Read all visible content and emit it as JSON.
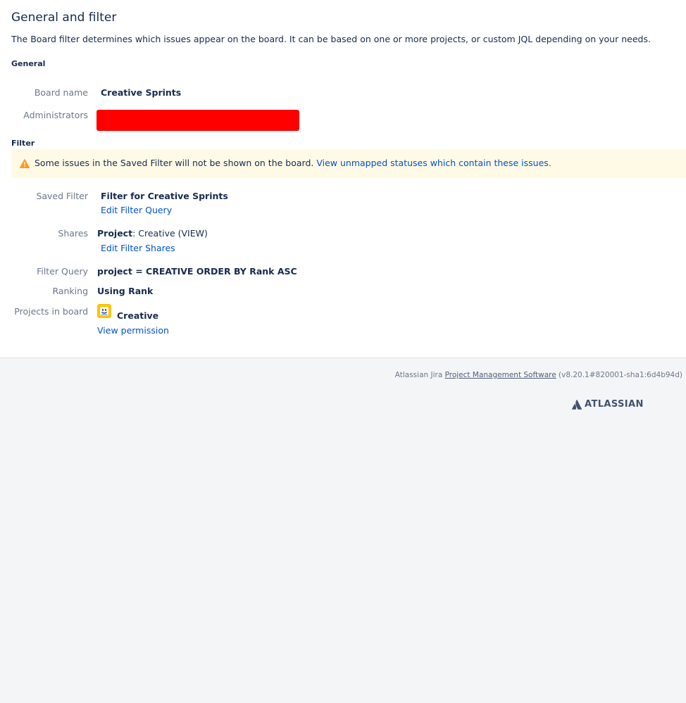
{
  "page": {
    "title": "General and filter",
    "description": "The Board filter determines which issues appear on the board. It can be based on one or more projects, or custom JQL depending on your needs."
  },
  "general": {
    "heading": "General",
    "board_name_label": "Board name",
    "board_name_value": "Creative Sprints",
    "administrators_label": "Administrators"
  },
  "filter": {
    "heading": "Filter",
    "warning_text": "Some issues in the Saved Filter will not be shown on the board.",
    "warning_link": "View unmapped statuses which contain these issues.",
    "saved_filter_label": "Saved Filter",
    "saved_filter_value": "Filter for Creative Sprints",
    "edit_filter_query": "Edit Filter Query",
    "shares_label": "Shares",
    "shares_key": "Project",
    "shares_value": ": Creative (VIEW)",
    "edit_filter_shares": "Edit Filter Shares",
    "filter_query_label": "Filter Query",
    "filter_query_value": "project = CREATIVE ORDER BY Rank ASC",
    "ranking_label": "Ranking",
    "ranking_value": "Using Rank",
    "projects_label": "Projects in board",
    "project_name": "Creative",
    "view_permission": "View permission"
  },
  "footer": {
    "prefix": "Atlassian Jira",
    "link": "Project Management Software",
    "version": "(v8.20.1#820001-sha1:6d4b94d)",
    "logo_text": "ATLASSIAN"
  },
  "colors": {
    "warning_bg": "#fffae6",
    "warning_icon": "#ff991f",
    "link": "#0052cc",
    "redaction": "#ff0000",
    "avatar": "#ffc400"
  },
  "icons": [
    "warning-icon",
    "project-avatar-icon",
    "atlassian-logo-icon"
  ]
}
